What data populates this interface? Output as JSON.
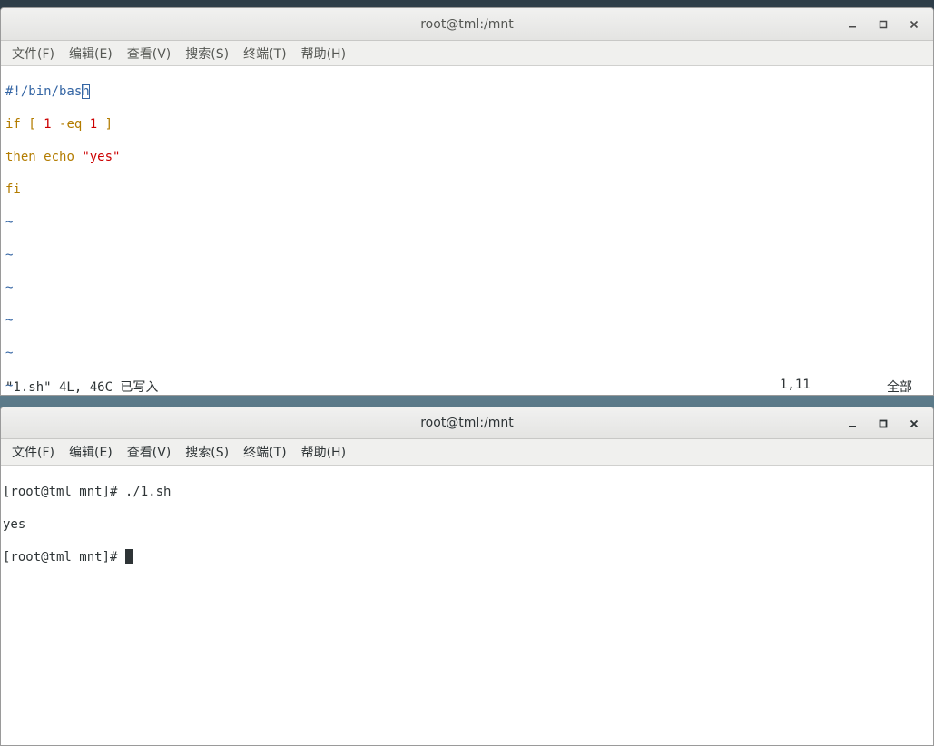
{
  "editor_window": {
    "title": "root@tml:/mnt",
    "menu": [
      "文件(F)",
      "编辑(E)",
      "查看(V)",
      "搜索(S)",
      "终端(T)",
      "帮助(H)"
    ],
    "code": {
      "shebang_before_cursor": "#!/bin/bas",
      "shebang_cursor_char": "h",
      "line2_kw": "if",
      "line2_bracket_open": "[",
      "line2_num1": "1",
      "line2_op": "-eq",
      "line2_num2": "1",
      "line2_bracket_close": "]",
      "line3_kw": "then",
      "line3_cmd": "echo",
      "line3_str": "\"yes\"",
      "line4_kw": "fi",
      "tilde": "~"
    },
    "status": {
      "file_info": "\"1.sh\" 4L, 46C 已写入",
      "position": "1,11",
      "scroll": "全部"
    }
  },
  "shell_window": {
    "title": "root@tml:/mnt",
    "menu": [
      "文件(F)",
      "编辑(E)",
      "查看(V)",
      "搜索(S)",
      "终端(T)",
      "帮助(H)"
    ],
    "lines": {
      "prompt1": "[root@tml mnt]# ",
      "command1": "./1.sh",
      "output1": "yes",
      "prompt2": "[root@tml mnt]# "
    }
  },
  "icons": {
    "minimize": "minimize-icon",
    "maximize": "maximize-icon",
    "close": "close-icon"
  }
}
